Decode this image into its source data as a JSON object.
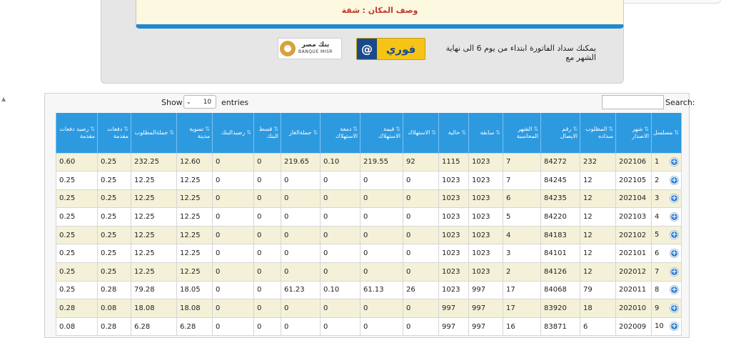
{
  "header": {
    "location_label": "وصف المكان :",
    "location_value": "شقة"
  },
  "payment": {
    "text": "يمكنك سداد الفاتورة ابتداء من يوم 6 الى نهاية الشهر مع",
    "fawry_symbol": "@",
    "fawry_name": "فوري",
    "banque_ar": "بنك مصر",
    "banque_en": "BANQUE MISR"
  },
  "controls": {
    "show_label": "Show",
    "page_size": "10",
    "entries_label": "entries",
    "search_label": "Search:",
    "search_value": ""
  },
  "table": {
    "columns": [
      "مسلسل",
      "شهر الاصدار",
      "المطلوب سداده",
      "رقم الايصال",
      "الشهر المحاسبة",
      "سابقة",
      "حالية",
      "الاستهلاك",
      "قيمة الاستهلاك",
      "دمغة الاستهلاك",
      "جملةالغاز",
      "قسط البنك",
      "رصيدالبنك",
      "تسوية مدينة",
      "جملةالمطلوب",
      "دفعات مقدمة",
      "رصيد دفعات مقدمة"
    ],
    "rows": [
      [
        "1",
        "202106",
        "232",
        "84272",
        "7",
        "1023",
        "1115",
        "92",
        "219.55",
        "0.10",
        "219.65",
        "0",
        "0",
        "12.60",
        "232.25",
        "0.25",
        "0.60"
      ],
      [
        "2",
        "202105",
        "12",
        "84245",
        "7",
        "1023",
        "1023",
        "0",
        "0",
        "0",
        "0",
        "0",
        "0",
        "12.25",
        "12.25",
        "0.25",
        "0.25"
      ],
      [
        "3",
        "202104",
        "12",
        "84235",
        "6",
        "1023",
        "1023",
        "0",
        "0",
        "0",
        "0",
        "0",
        "0",
        "12.25",
        "12.25",
        "0.25",
        "0.25"
      ],
      [
        "4",
        "202103",
        "12",
        "84220",
        "5",
        "1023",
        "1023",
        "0",
        "0",
        "0",
        "0",
        "0",
        "0",
        "12.25",
        "12.25",
        "0.25",
        "0.25"
      ],
      [
        "5",
        "202102",
        "12",
        "84183",
        "4",
        "1023",
        "1023",
        "0",
        "0",
        "0",
        "0",
        "0",
        "0",
        "12.25",
        "12.25",
        "0.25",
        "0.25"
      ],
      [
        "6",
        "202101",
        "12",
        "84101",
        "3",
        "1023",
        "1023",
        "0",
        "0",
        "0",
        "0",
        "0",
        "0",
        "12.25",
        "12.25",
        "0.25",
        "0.25"
      ],
      [
        "7",
        "202012",
        "12",
        "84126",
        "2",
        "1023",
        "1023",
        "0",
        "0",
        "0",
        "0",
        "0",
        "0",
        "12.25",
        "12.25",
        "0.25",
        "0.25"
      ],
      [
        "8",
        "202011",
        "79",
        "84068",
        "17",
        "997",
        "1023",
        "26",
        "61.13",
        "0.10",
        "61.23",
        "0",
        "0",
        "18.05",
        "79.28",
        "0.28",
        "0.25"
      ],
      [
        "9",
        "202010",
        "18",
        "83920",
        "17",
        "997",
        "997",
        "0",
        "0",
        "0",
        "0",
        "0",
        "0",
        "18.08",
        "18.08",
        "0.08",
        "0.28"
      ],
      [
        "10",
        "202009",
        "6",
        "83871",
        "16",
        "997",
        "997",
        "0",
        "0",
        "0",
        "0",
        "0",
        "0",
        "6.28",
        "6.28",
        "0.28",
        "0.08"
      ]
    ]
  },
  "icons": {
    "expand": "plus-circle-icon",
    "sort": "sort-arrows-icon",
    "select_chevron": "chevron-down-icon"
  },
  "colors": {
    "header_blue": "#2d9ae0",
    "odd_row": "#f4f1d8",
    "accent_bar": "#1f8ad0",
    "fawry_yellow": "#f6c416"
  }
}
